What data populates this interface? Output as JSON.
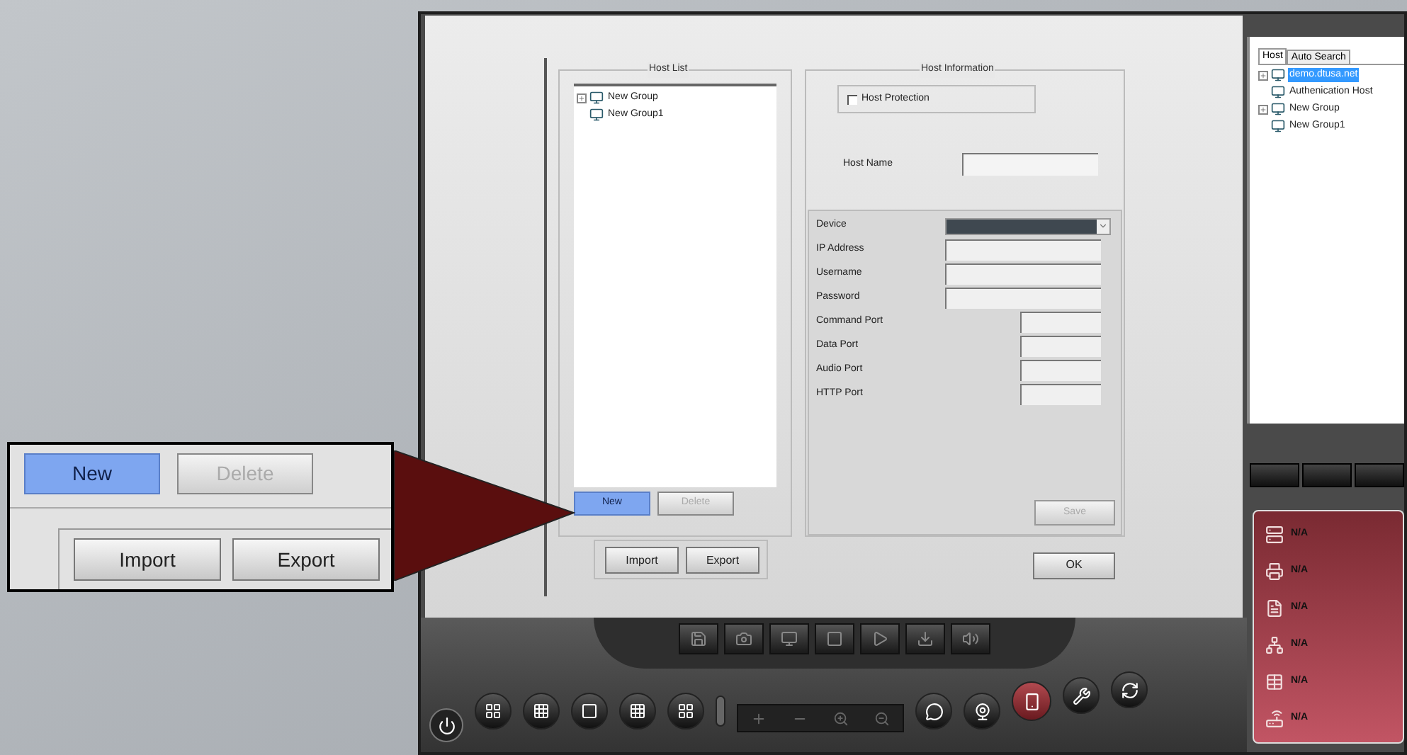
{
  "callout": {
    "buttons": [
      {
        "label": "New",
        "highlighted": true,
        "disabled": false
      },
      {
        "label": "Delete",
        "highlighted": false,
        "disabled": true
      }
    ],
    "file_buttons": [
      {
        "label": "Import"
      },
      {
        "label": "Export"
      }
    ]
  },
  "host_list": {
    "title": "Host List",
    "items": [
      {
        "label": "New Group",
        "kind": "collapsed"
      },
      {
        "label": "New Group1",
        "kind": "leaf"
      }
    ],
    "buttons": [
      {
        "label": "New",
        "highlighted": true,
        "disabled": false
      },
      {
        "label": "Delete",
        "highlighted": false,
        "disabled": true
      }
    ]
  },
  "host_information": {
    "title": "Host Information",
    "host_protection": {
      "label": "Host Protection",
      "checked": false
    },
    "host_name": {
      "label": "Host Name"
    },
    "fields": [
      {
        "label": "Device",
        "kind": "dropdown"
      },
      {
        "label": "IP Address",
        "kind": "wide"
      },
      {
        "label": "Username",
        "kind": "wide"
      },
      {
        "label": "Password",
        "kind": "wide"
      },
      {
        "label": "Command Port",
        "kind": "short"
      },
      {
        "label": "Data Port",
        "kind": "short"
      },
      {
        "label": "Audio Port",
        "kind": "short"
      },
      {
        "label": "HTTP Port",
        "kind": "short"
      }
    ],
    "save_button": {
      "label": "Save",
      "disabled": true
    }
  },
  "file_buttons": [
    {
      "label": "Import"
    },
    {
      "label": "Export"
    }
  ],
  "ok_button": {
    "label": "OK"
  },
  "host_panel": {
    "tabs": [
      {
        "label": "Host",
        "selected": true
      },
      {
        "label": "Auto Search",
        "selected": false
      }
    ],
    "items": [
      {
        "label": "demo.dtusa.net",
        "kind": "collapsed",
        "selected": true
      },
      {
        "label": "Authenication Host",
        "kind": "leaf",
        "selected": false
      },
      {
        "label": "New Group",
        "kind": "collapsed",
        "selected": false
      },
      {
        "label": "New Group1",
        "kind": "leaf",
        "selected": false
      }
    ]
  },
  "status_panel": {
    "rows": [
      {
        "kind": "server",
        "value": "N/A"
      },
      {
        "kind": "printer",
        "value": "N/A"
      },
      {
        "kind": "ip",
        "value": "N/A"
      },
      {
        "kind": "network",
        "value": "N/A"
      },
      {
        "kind": "grid",
        "value": "N/A"
      },
      {
        "kind": "router",
        "value": "N/A"
      }
    ]
  }
}
